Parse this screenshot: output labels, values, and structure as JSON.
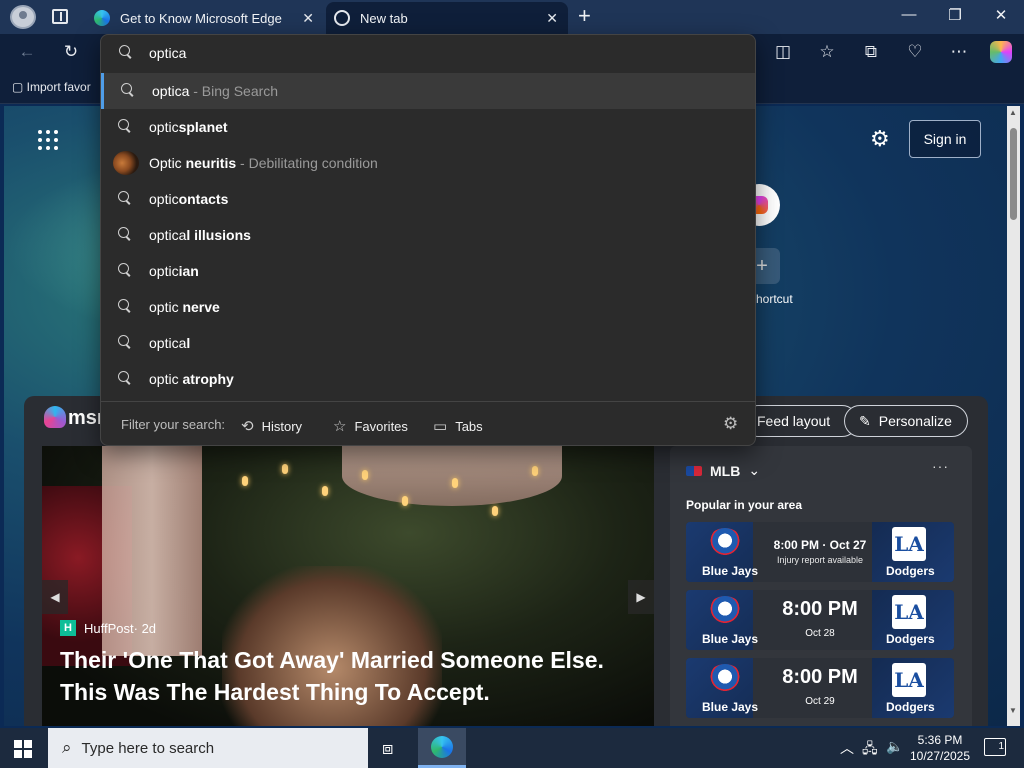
{
  "browser": {
    "tabs": [
      {
        "title": "Get to Know Microsoft Edge"
      },
      {
        "title": "New tab"
      }
    ],
    "favorites_bar": {
      "import_label": "Import favor"
    }
  },
  "omnibox": {
    "query": "optica",
    "suggestions": [
      {
        "plain": "optica",
        "bold": "",
        "hint": " - Bing Search",
        "icon": "search-icon",
        "active": true
      },
      {
        "plain": "optic",
        "bold": "splanet",
        "hint": "",
        "icon": "search-icon"
      },
      {
        "plain": "Optic ",
        "bold": "neuritis",
        "hint": " - Debilitating condition",
        "icon": "thumbnail-image"
      },
      {
        "plain": "optic",
        "bold": "ontacts",
        "hint": "",
        "icon": "search-icon"
      },
      {
        "plain": "optica",
        "bold": "l illusions",
        "hint": "",
        "icon": "search-icon"
      },
      {
        "plain": "optic",
        "bold": "ian",
        "hint": "",
        "icon": "search-icon"
      },
      {
        "plain": "optic ",
        "bold": "nerve",
        "hint": "",
        "icon": "search-icon"
      },
      {
        "plain": "optica",
        "bold": "l",
        "hint": "",
        "icon": "search-icon"
      },
      {
        "plain": "optic ",
        "bold": "atrophy",
        "hint": "",
        "icon": "search-icon"
      }
    ],
    "filter": {
      "label": "Filter your search:",
      "history": "History",
      "favorites": "Favorites",
      "tabs": "Tabs"
    }
  },
  "ntp": {
    "sign_in": "Sign in",
    "shortcut_label": "hortcut",
    "feed": {
      "logo_text": "msn",
      "feed_layout": "Feed layout",
      "personalize": "Personalize",
      "hero": {
        "source": "HuffPost",
        "age": " · 2d",
        "title": "Their 'One That Got Away' Married Someone Else. This Was The Hardest Thing To Accept."
      },
      "sports": {
        "league": "MLB",
        "subtitle": "Popular in your area",
        "games": [
          {
            "home": "Blue Jays",
            "away": "Dodgers",
            "time": "8:00 PM · Oct 27",
            "note": "Injury report available"
          },
          {
            "home": "Blue Jays",
            "away": "Dodgers",
            "time": "8:00 PM",
            "date": "Oct 28"
          },
          {
            "home": "Blue Jays",
            "away": "Dodgers",
            "time": "8:00 PM",
            "date": "Oct 29"
          }
        ]
      }
    }
  },
  "taskbar": {
    "search_placeholder": "Type here to search",
    "time": "5:36 PM",
    "date": "10/27/2025",
    "notifications": "1"
  }
}
